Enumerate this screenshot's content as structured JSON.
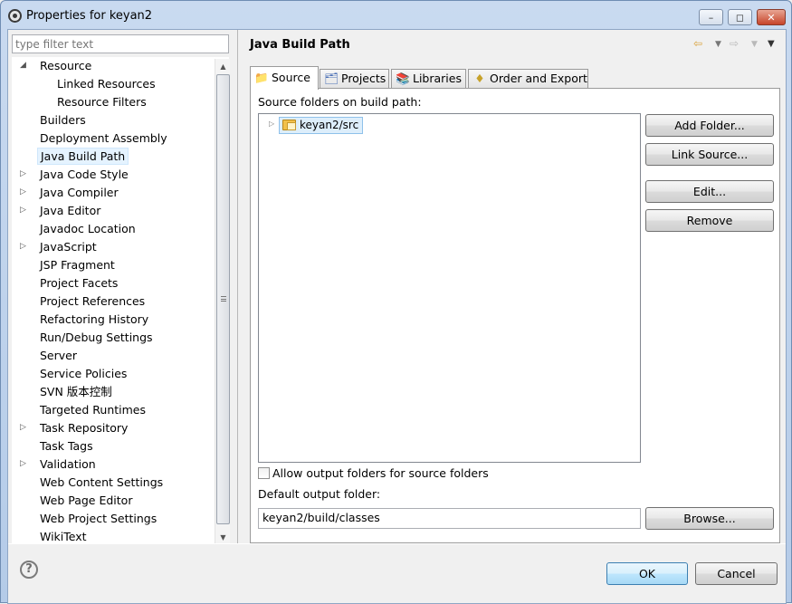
{
  "window": {
    "title": "Properties for keyan2"
  },
  "filter": {
    "placeholder": "type filter text"
  },
  "tree": {
    "items": [
      {
        "label": "Resource",
        "toggle": "◢",
        "indent": 1
      },
      {
        "label": "Linked Resources",
        "toggle": "",
        "indent": 2
      },
      {
        "label": "Resource Filters",
        "toggle": "",
        "indent": 2
      },
      {
        "label": "Builders",
        "toggle": "",
        "indent": 1
      },
      {
        "label": "Deployment Assembly",
        "toggle": "",
        "indent": 1
      },
      {
        "label": "Java Build Path",
        "toggle": "",
        "indent": 1,
        "selected": true
      },
      {
        "label": "Java Code Style",
        "toggle": "▷",
        "indent": 1
      },
      {
        "label": "Java Compiler",
        "toggle": "▷",
        "indent": 1
      },
      {
        "label": "Java Editor",
        "toggle": "▷",
        "indent": 1
      },
      {
        "label": "Javadoc Location",
        "toggle": "",
        "indent": 1
      },
      {
        "label": "JavaScript",
        "toggle": "▷",
        "indent": 1
      },
      {
        "label": "JSP Fragment",
        "toggle": "",
        "indent": 1
      },
      {
        "label": "Project Facets",
        "toggle": "",
        "indent": 1
      },
      {
        "label": "Project References",
        "toggle": "",
        "indent": 1
      },
      {
        "label": "Refactoring History",
        "toggle": "",
        "indent": 1
      },
      {
        "label": "Run/Debug Settings",
        "toggle": "",
        "indent": 1
      },
      {
        "label": "Server",
        "toggle": "",
        "indent": 1
      },
      {
        "label": "Service Policies",
        "toggle": "",
        "indent": 1
      },
      {
        "label": "SVN 版本控制",
        "toggle": "",
        "indent": 1
      },
      {
        "label": "Targeted Runtimes",
        "toggle": "",
        "indent": 1
      },
      {
        "label": "Task Repository",
        "toggle": "▷",
        "indent": 1
      },
      {
        "label": "Task Tags",
        "toggle": "",
        "indent": 1
      },
      {
        "label": "Validation",
        "toggle": "▷",
        "indent": 1
      },
      {
        "label": "Web Content Settings",
        "toggle": "",
        "indent": 1
      },
      {
        "label": "Web Page Editor",
        "toggle": "",
        "indent": 1
      },
      {
        "label": "Web Project Settings",
        "toggle": "",
        "indent": 1
      },
      {
        "label": "WikiText",
        "toggle": "",
        "indent": 1
      }
    ]
  },
  "page": {
    "title": "Java Build Path"
  },
  "tabs": [
    {
      "label": "Source",
      "icon": "source-folder-icon",
      "active": true
    },
    {
      "label": "Projects",
      "icon": "projects-icon"
    },
    {
      "label": "Libraries",
      "icon": "libraries-icon"
    },
    {
      "label": "Order and Export",
      "icon": "order-export-icon"
    }
  ],
  "source": {
    "heading": "Source folders on build path:",
    "folders": [
      "keyan2/src"
    ],
    "buttons": {
      "add_folder": "Add Folder...",
      "link_source": "Link Source...",
      "edit": "Edit...",
      "remove": "Remove"
    },
    "allow_output_label": "Allow output folders for source folders",
    "allow_output_checked": false,
    "default_output_label": "Default output folder:",
    "default_output_value": "keyan2/build/classes",
    "browse": "Browse..."
  },
  "footer": {
    "ok": "OK",
    "cancel": "Cancel"
  }
}
